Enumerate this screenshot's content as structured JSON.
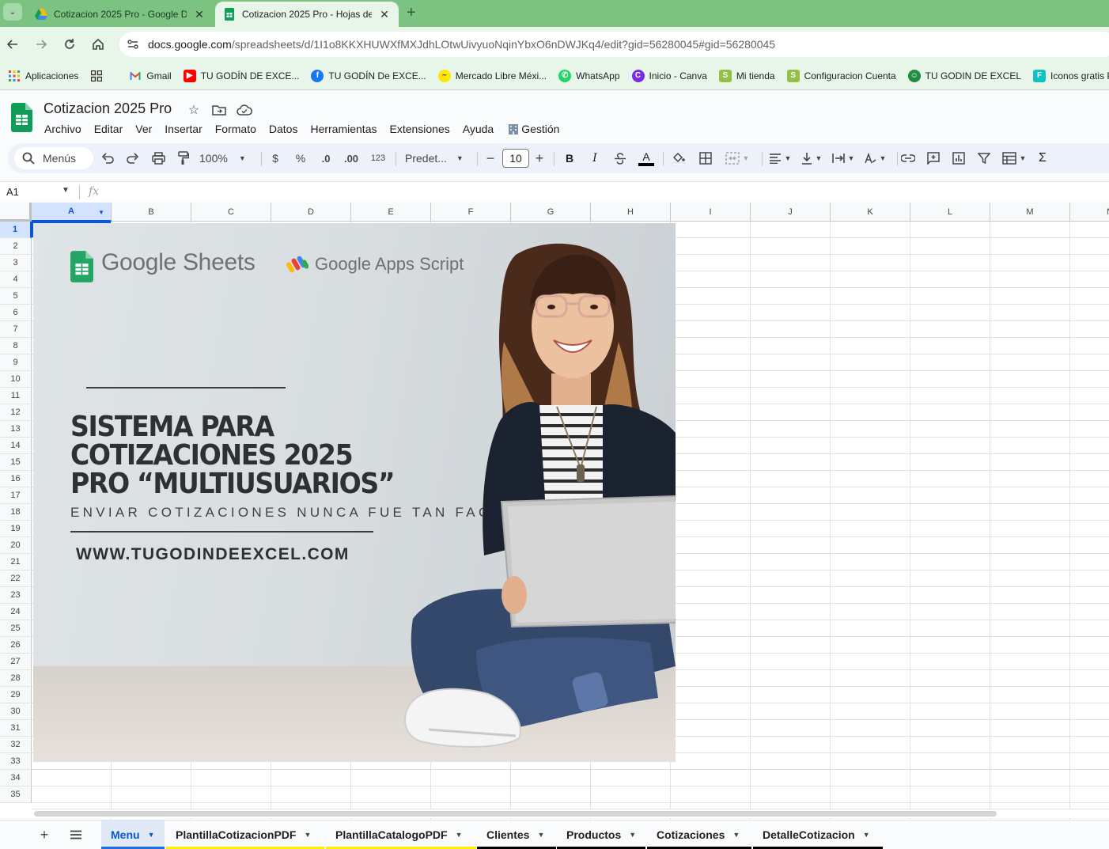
{
  "browser": {
    "tabs": [
      {
        "title": "Cotizacion 2025 Pro - Google D",
        "icon": "google-drive-icon",
        "active": false
      },
      {
        "title": "Cotizacion 2025 Pro - Hojas de",
        "icon": "google-sheets-icon",
        "active": true
      }
    ],
    "close_glyph": "✕",
    "new_tab_glyph": "+",
    "address": {
      "host": "docs.google.com",
      "path": "/spreadsheets/d/1I1o8KKXHUWXfMXJdhLOtwUivyuoNqinYbxO6nDWJKq4/edit?gid=56280045#gid=56280045"
    },
    "bookmarks": [
      {
        "label": "Aplicaciones",
        "icon": "apps-grid-icon"
      },
      {
        "label": "",
        "icon": "grid-icon"
      },
      {
        "label": "Gmail",
        "icon": "gmail-icon"
      },
      {
        "label": "TU GODÍN DE EXCE...",
        "icon": "youtube-icon"
      },
      {
        "label": "TU GODÍN De EXCE...",
        "icon": "facebook-icon"
      },
      {
        "label": "Mercado Libre Méxi...",
        "icon": "mercadolibre-icon"
      },
      {
        "label": "WhatsApp",
        "icon": "whatsapp-icon"
      },
      {
        "label": "Inicio - Canva",
        "icon": "canva-icon"
      },
      {
        "label": "Mi tienda",
        "icon": "shopify-icon"
      },
      {
        "label": "Configuracion Cuenta",
        "icon": "shopify-icon"
      },
      {
        "label": "TU GODIN DE EXCEL",
        "icon": "godin-icon"
      },
      {
        "label": "Iconos gratis PNG",
        "icon": "flaticon-icon"
      }
    ]
  },
  "doc": {
    "title": "Cotizacion 2025 Pro",
    "menus": [
      "Archivo",
      "Editar",
      "Ver",
      "Insertar",
      "Formato",
      "Datos",
      "Herramientas",
      "Extensiones",
      "Ayuda",
      "Gestión"
    ]
  },
  "toolbar": {
    "search_label": "Menús",
    "zoom": "100%",
    "currency": "$",
    "percent": "%",
    "dec_decrease": ".0",
    "dec_increase": ".00",
    "number_format": "123",
    "font": "Predet...",
    "font_size": "10",
    "bold": "B",
    "italic": "I",
    "text_color_letter": "A",
    "sum_glyph": "Σ"
  },
  "formula_bar": {
    "cell_ref": "A1",
    "fx": "fx",
    "value": ""
  },
  "grid": {
    "columns": [
      "A",
      "B",
      "C",
      "D",
      "E",
      "F",
      "G",
      "H",
      "I",
      "J",
      "K",
      "L",
      "M",
      "N"
    ],
    "rows": [
      "1",
      "2",
      "3",
      "4",
      "5",
      "6",
      "7",
      "8",
      "9",
      "10",
      "11",
      "12",
      "13",
      "14",
      "15",
      "16",
      "17",
      "18",
      "19",
      "20",
      "21",
      "22",
      "23",
      "24",
      "25",
      "26",
      "27",
      "28",
      "29",
      "30",
      "31",
      "32",
      "33",
      "34",
      "35"
    ],
    "selected_cell": "A1"
  },
  "banner": {
    "logo_sheets": "Google Sheets",
    "logo_apps_script": "Google Apps Script",
    "headline": "SISTEMA PARA\nCOTIZACIONES 2025\nPRO “MULTIUSUARIOS”",
    "tagline": "ENVIAR COTIZACIONES NUNCA FUE TAN FACIL",
    "website": "WWW.TUGODINDEEXCEL.COM"
  },
  "sheet_tabs": [
    {
      "label": "Menu",
      "active": true,
      "color": "#1e6fd9"
    },
    {
      "label": "PlantillaCotizacionPDF",
      "active": false,
      "color": "#fff200"
    },
    {
      "label": "PlantillaCatalogoPDF",
      "active": false,
      "color": "#fff200"
    },
    {
      "label": "Clientes",
      "active": false,
      "color": "#000000"
    },
    {
      "label": "Productos",
      "active": false,
      "color": "#000000"
    },
    {
      "label": "Cotizaciones",
      "active": false,
      "color": "#000000"
    },
    {
      "label": "DetalleCotizacion",
      "active": false,
      "color": "#000000"
    }
  ],
  "colors": {
    "chrome_frame": "#7cc382",
    "chrome_toolbar": "#e8f5e9",
    "selection_blue": "#0b57d0",
    "sheets_green": "#0f9d58"
  }
}
